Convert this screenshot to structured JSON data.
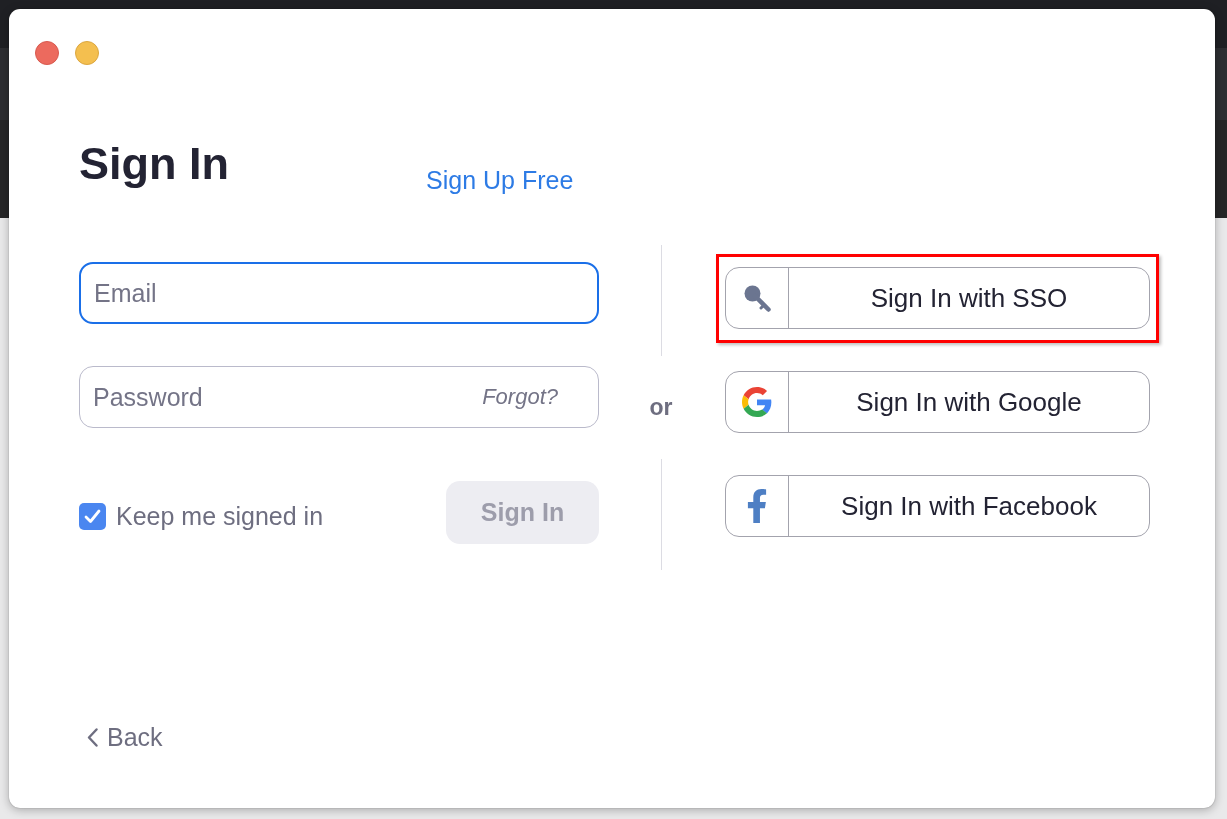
{
  "window": {
    "controls": [
      {
        "kind": "close",
        "color": "#ec6a5e"
      },
      {
        "kind": "minimize",
        "color": "#f4bf4f"
      }
    ]
  },
  "title": "Sign In",
  "sign_up_link": "Sign Up Free",
  "email_field": {
    "placeholder": "Email",
    "focused": true
  },
  "password_field": {
    "placeholder": "Password",
    "focused": false,
    "forgot_link": "Forgot?"
  },
  "keep_signed_in": {
    "label": "Keep me signed in",
    "checked": true
  },
  "sign_in_button": {
    "label": "Sign In",
    "disabled": true
  },
  "separator": "or",
  "providers": [
    {
      "kind": "sso",
      "label": "Sign In with SSO",
      "highlighted": true
    },
    {
      "kind": "google",
      "label": "Sign In with Google",
      "highlighted": false
    },
    {
      "kind": "facebook",
      "label": "Sign In with Facebook",
      "highlighted": false
    }
  ],
  "back_link": "Back"
}
